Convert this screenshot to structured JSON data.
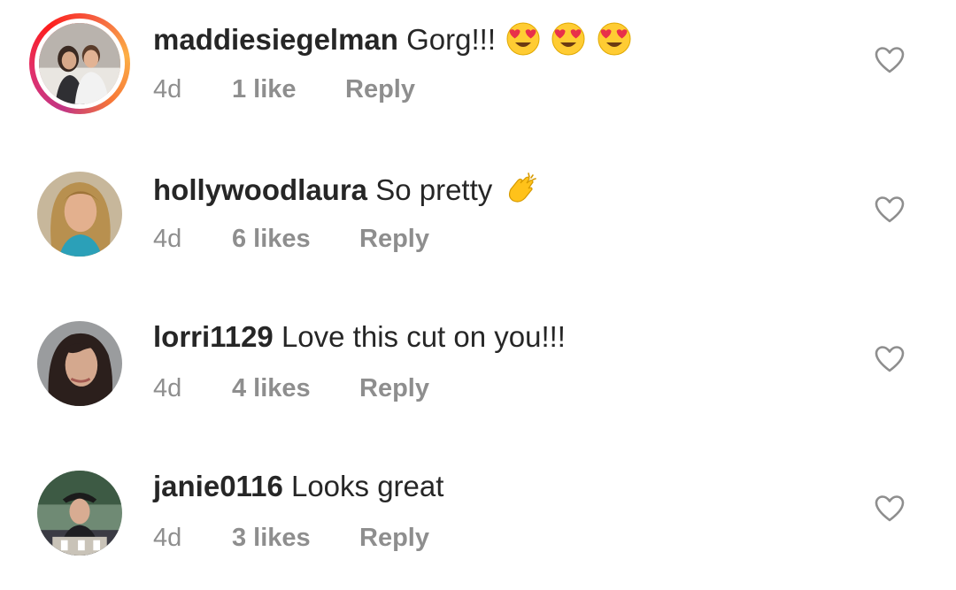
{
  "comments": [
    {
      "username": "maddiesiegelman",
      "text": "Gorg!!!",
      "emojis": [
        "heart-eyes-emoji",
        "heart-eyes-emoji",
        "heart-eyes-emoji"
      ],
      "time": "4d",
      "likes": "1 like",
      "reply": "Reply",
      "has_story": true
    },
    {
      "username": "hollywoodlaura",
      "text": "So pretty",
      "emojis": [
        "clapping-hands-emoji"
      ],
      "time": "4d",
      "likes": "6 likes",
      "reply": "Reply",
      "has_story": false
    },
    {
      "username": "lorri1129",
      "text": "Love this cut on you!!!",
      "emojis": [],
      "time": "4d",
      "likes": "4 likes",
      "reply": "Reply",
      "has_story": false
    },
    {
      "username": "janie0116",
      "text": "Looks great",
      "emojis": [],
      "time": "4d",
      "likes": "3 likes",
      "reply": "Reply",
      "has_story": false
    }
  ],
  "icons": {
    "like": "heart-outline-icon"
  },
  "colors": {
    "text": "#262626",
    "meta": "#8e8e8e",
    "story_ring_start": "#c13584",
    "story_ring_end": "#fcaf45",
    "emoji_yellow": "#ffcc33",
    "emoji_heart": "#e8304a"
  }
}
